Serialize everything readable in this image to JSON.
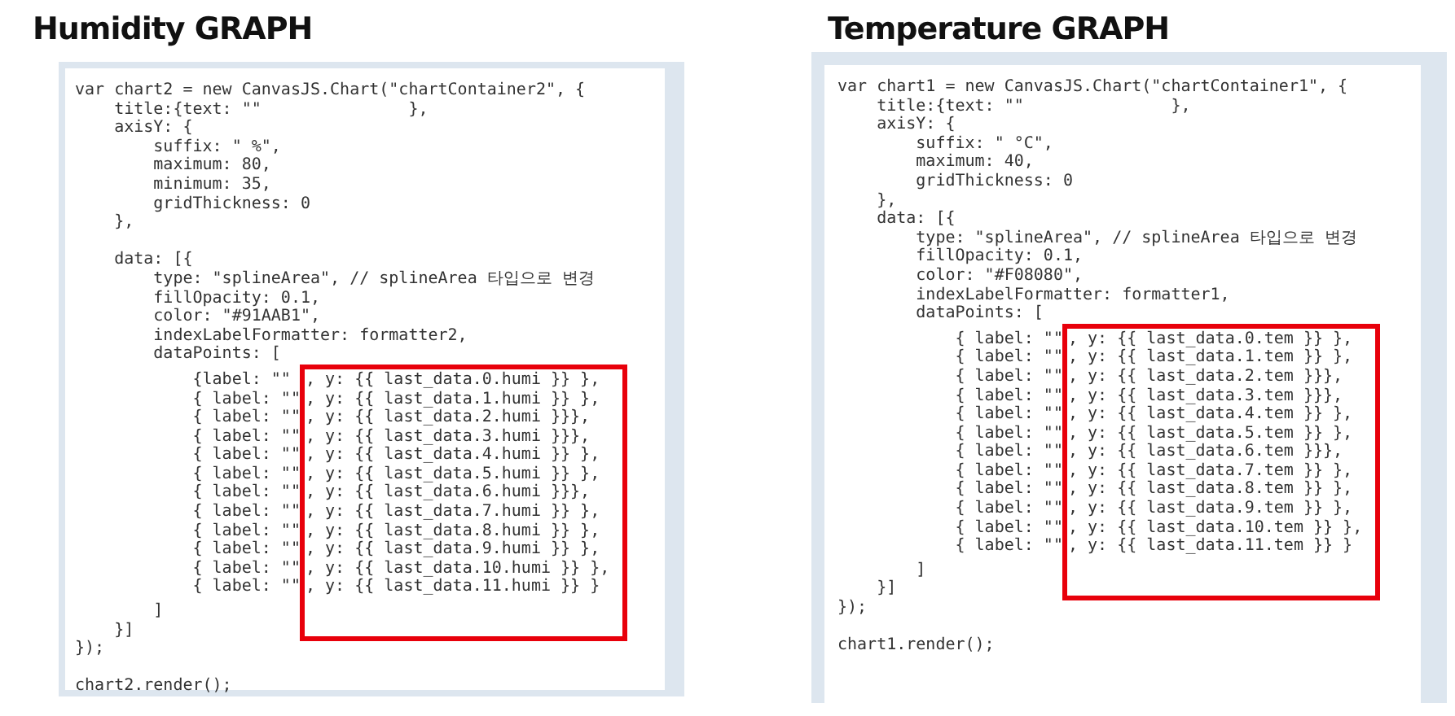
{
  "panels": [
    {
      "heading": "Humidity GRAPH",
      "before": [
        {
          "kind": "code",
          "text": "var chart2 = new CanvasJS.Chart(\"chartContainer2\", {"
        },
        {
          "kind": "code",
          "text": "    title:{text: \"\"               },"
        },
        {
          "kind": "code",
          "text": "    axisY: {"
        },
        {
          "kind": "code",
          "text": "        suffix: \" %\","
        },
        {
          "kind": "code",
          "text": "        maximum: 80,"
        },
        {
          "kind": "code",
          "text": "        minimum: 35,"
        },
        {
          "kind": "code",
          "text": "        gridThickness: 0"
        },
        {
          "kind": "code",
          "text": "    },"
        },
        {
          "kind": "blank"
        },
        {
          "kind": "code",
          "text": "    data: [{"
        },
        {
          "kind": "code",
          "text": "        type: \"splineArea\", // splineArea 타입으로 변경"
        },
        {
          "kind": "code",
          "text": "        fillOpacity: 0.1,"
        },
        {
          "kind": "code",
          "text": "        color: \"#91AAB1\","
        },
        {
          "kind": "code",
          "text": "        indexLabelFormatter: formatter2,"
        },
        {
          "kind": "code",
          "text": "        dataPoints: ["
        }
      ],
      "highlighted": [
        {
          "prefix": "            {label: \"\"",
          "text": ", y: {{ last_data.0.humi }} },"
        },
        {
          "prefix": "            { label: \"\"",
          "text": ", y: {{ last_data.1.humi }} },"
        },
        {
          "prefix": "            { label: \"\"",
          "text": ", y: {{ last_data.2.humi }}},"
        },
        {
          "prefix": "            { label: \"\"",
          "text": ", y: {{ last_data.3.humi }}},"
        },
        {
          "prefix": "            { label: \"\"",
          "text": ", y: {{ last_data.4.humi }} },"
        },
        {
          "prefix": "            { label: \"\"",
          "text": ", y: {{ last_data.5.humi }} },"
        },
        {
          "prefix": "            { label: \"\"",
          "text": ", y: {{ last_data.6.humi }}},"
        },
        {
          "prefix": "            { label: \"\"",
          "text": ", y: {{ last_data.7.humi }} },"
        },
        {
          "prefix": "            { label: \"\"",
          "text": ", y: {{ last_data.8.humi }} },"
        },
        {
          "prefix": "            { label: \"\"",
          "text": ", y: {{ last_data.9.humi }} },"
        },
        {
          "prefix": "            { label: \"\"",
          "text": ", y: {{ last_data.10.humi }} },"
        },
        {
          "prefix": "            { label: \"\"",
          "text": ", y: {{ last_data.11.humi }} }"
        }
      ],
      "after": [
        {
          "kind": "code",
          "text": "        ]"
        },
        {
          "kind": "code",
          "text": "    }]"
        },
        {
          "kind": "code",
          "text": "});"
        },
        {
          "kind": "blank"
        },
        {
          "kind": "code",
          "text": "chart2.render();"
        }
      ]
    },
    {
      "heading": "Temperature GRAPH",
      "before": [
        {
          "kind": "code",
          "text": "var chart1 = new CanvasJS.Chart(\"chartContainer1\", {"
        },
        {
          "kind": "code",
          "text": "    title:{text: \"\"               },"
        },
        {
          "kind": "code",
          "text": "    axisY: {"
        },
        {
          "kind": "code",
          "text": "        suffix: \" °C\","
        },
        {
          "kind": "code",
          "text": "        maximum: 40,"
        },
        {
          "kind": "code",
          "text": "        gridThickness: 0"
        },
        {
          "kind": "code",
          "text": "    },"
        },
        {
          "kind": "code",
          "text": "    data: [{"
        },
        {
          "kind": "code",
          "text": "        type: \"splineArea\", // splineArea 타입으로 변경"
        },
        {
          "kind": "code",
          "text": "        fillOpacity: 0.1,"
        },
        {
          "kind": "code",
          "text": "        color: \"#F08080\","
        },
        {
          "kind": "code",
          "text": "        indexLabelFormatter: formatter1,"
        },
        {
          "kind": "code",
          "text": "        dataPoints: ["
        }
      ],
      "highlighted": [
        {
          "prefix": "            { label: \"\"",
          "text": ", y: {{ last_data.0.tem }} },"
        },
        {
          "prefix": "            { label: \"\"",
          "text": ", y: {{ last_data.1.tem }} },"
        },
        {
          "prefix": "            { label: \"\"",
          "text": ", y: {{ last_data.2.tem }}},"
        },
        {
          "prefix": "            { label: \"\"",
          "text": ", y: {{ last_data.3.tem }}},"
        },
        {
          "prefix": "            { label: \"\"",
          "text": ", y: {{ last_data.4.tem }} },"
        },
        {
          "prefix": "            { label: \"\"",
          "text": ", y: {{ last_data.5.tem }} },"
        },
        {
          "prefix": "            { label: \"\"",
          "text": ", y: {{ last_data.6.tem }}},"
        },
        {
          "prefix": "            { label: \"\"",
          "text": ", y: {{ last_data.7.tem }} },"
        },
        {
          "prefix": "            { label: \"\"",
          "text": ", y: {{ last_data.8.tem }} },"
        },
        {
          "prefix": "            { label: \"\"",
          "text": ", y: {{ last_data.9.tem }} },"
        },
        {
          "prefix": "            { label: \"\"",
          "text": ", y: {{ last_data.10.tem }} },"
        },
        {
          "prefix": "            { label: \"\"",
          "text": ", y: {{ last_data.11.tem }} }"
        }
      ],
      "after": [
        {
          "kind": "code",
          "text": "        ]"
        },
        {
          "kind": "code",
          "text": "    }]"
        },
        {
          "kind": "code",
          "text": "});"
        },
        {
          "kind": "blank"
        },
        {
          "kind": "code",
          "text": "chart1.render();"
        }
      ]
    }
  ]
}
